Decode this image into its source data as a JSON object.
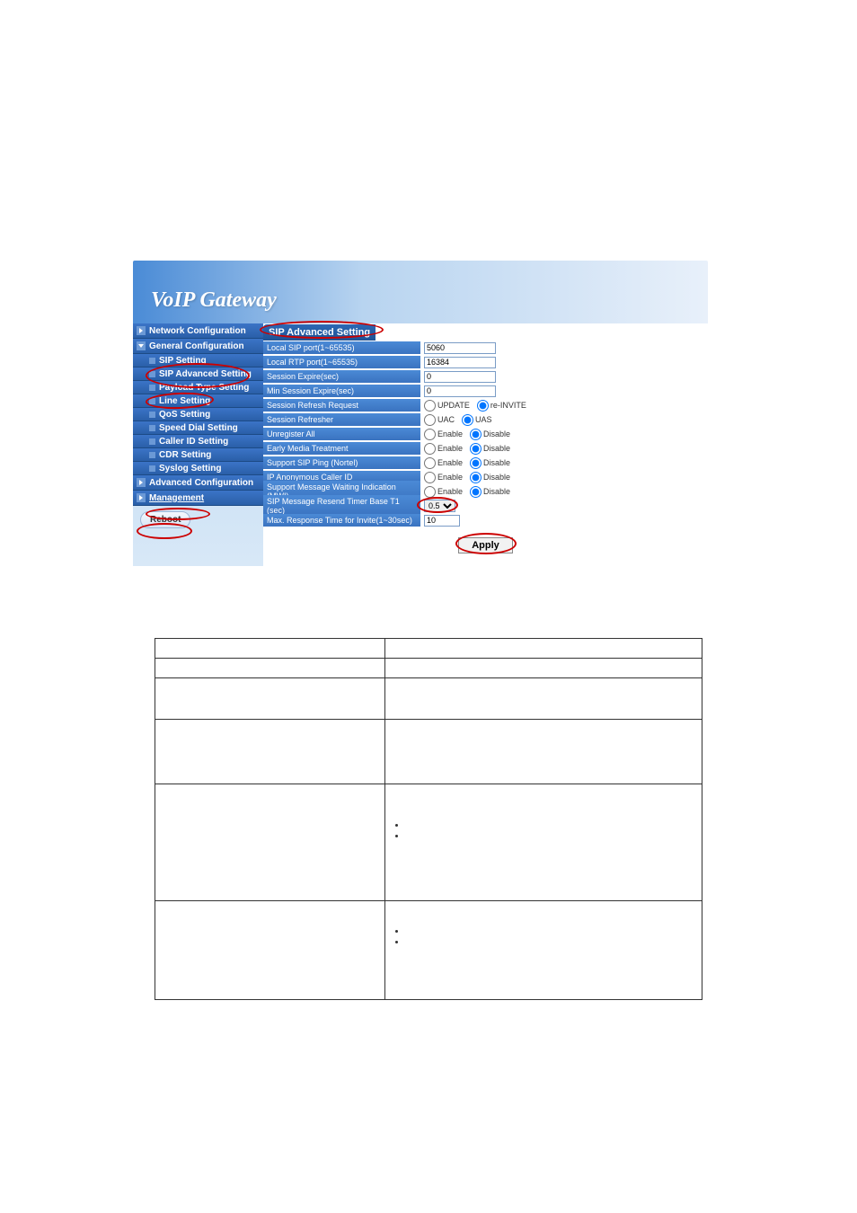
{
  "header": {
    "title": "VoIP Gateway"
  },
  "sidebar": {
    "cat1": "Network Configuration",
    "cat2": "General Configuration",
    "items": [
      "SIP Setting",
      "SIP Advanced Setting",
      "Payload Type Setting",
      "Line Setting",
      "QoS Setting",
      "Speed Dial Setting",
      "Caller ID Setting",
      "CDR Setting",
      "Syslog Setting"
    ],
    "cat3": "Advanced Configuration",
    "cat4": "Management",
    "reboot": "Reboot"
  },
  "panel": {
    "title": "SIP Advanced Setting",
    "rows": {
      "local_sip_port": {
        "label": "Local SIP port(1~65535)",
        "value": "5060"
      },
      "local_rtp_port": {
        "label": "Local RTP port(1~65535)",
        "value": "16384"
      },
      "session_expire": {
        "label": "Session Expire(sec)",
        "value": "0"
      },
      "min_session_expire": {
        "label": "Min Session Expire(sec)",
        "value": "0"
      },
      "session_refresh": {
        "label": "Session Refresh Request",
        "opt1": "UPDATE",
        "opt2": "re-INVITE"
      },
      "session_refresher": {
        "label": "Session Refresher",
        "opt1": "UAC",
        "opt2": "UAS"
      },
      "unregister_all": {
        "label": "Unregister All",
        "opt1": "Enable",
        "opt2": "Disable"
      },
      "early_media": {
        "label": "Early Media Treatment",
        "opt1": "Enable",
        "opt2": "Disable"
      },
      "sip_ping": {
        "label": "Support SIP Ping (Nortel)",
        "opt1": "Enable",
        "opt2": "Disable"
      },
      "anon_caller": {
        "label": "IP Anonymous Caller ID",
        "opt1": "Enable",
        "opt2": "Disable"
      },
      "mwi": {
        "label": "Support Message Waiting Indication (MWI)",
        "opt1": "Enable",
        "opt2": "Disable"
      },
      "resend_timer": {
        "label": "SIP Message Resend Timer Base T1 (sec)",
        "value": "0.5"
      },
      "max_response": {
        "label": "Max. Response Time for Invite(1~30sec)",
        "value": "10"
      }
    },
    "apply": "Apply"
  },
  "desc_table": {
    "r1c1": "",
    "r1c2": "",
    "r2c1": "",
    "r2c2": "",
    "r3c1": "",
    "r3c2": "",
    "r4c1": "",
    "r4c2": "",
    "r5c1": "",
    "r5c2": "",
    "r6c1": "",
    "r6c2": ""
  }
}
